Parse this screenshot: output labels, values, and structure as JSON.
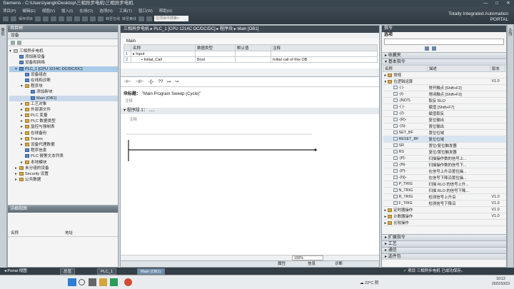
{
  "window": {
    "title": "Siemens  -  C:\\Users\\yangk\\Desktop\\三相异步电机\\三相异步电机",
    "controls": [
      "—",
      "□",
      "✕"
    ]
  },
  "menu": [
    "项目(P)",
    "编辑(E)",
    "视图(V)",
    "插入(I)",
    "在线(O)",
    "选项(N)",
    "工具(T)",
    "窗口(W)",
    "帮助(H)"
  ],
  "toolbar": {
    "save_label": "保存项目",
    "online_label": "转至在线",
    "offline_label": "转至离线",
    "search_placeholder": "在项目中搜索>"
  },
  "brand": {
    "line1": "Totally Integrated Automation",
    "line2": "PORTAL"
  },
  "project_tree": {
    "title": "项目树",
    "devices_tab": "设备",
    "side_tab": "设备",
    "items": [
      {
        "label": "三相异步电机",
        "indent": 0,
        "exp": "▾",
        "icon": "grey"
      },
      {
        "label": "添加新设备",
        "indent": 1,
        "exp": "",
        "icon": "blue"
      },
      {
        "label": "设备和网络",
        "indent": 1,
        "exp": "",
        "icon": "blue"
      },
      {
        "label": "PLC_1 [CPU 1214C DC/DC/DC]",
        "indent": 1,
        "exp": "▾",
        "icon": "blue",
        "sel": true
      },
      {
        "label": "设备组态",
        "indent": 2,
        "exp": "",
        "icon": "blue"
      },
      {
        "label": "在线和诊断",
        "indent": 2,
        "exp": "",
        "icon": "blue"
      },
      {
        "label": "程序块",
        "indent": 2,
        "exp": "▾",
        "icon": "folder"
      },
      {
        "label": "添加新块",
        "indent": 3,
        "exp": "",
        "icon": "blue"
      },
      {
        "label": "Main [OB1]",
        "indent": 3,
        "exp": "",
        "icon": "blue",
        "sel2": true
      },
      {
        "label": "工艺对象",
        "indent": 2,
        "exp": "▸",
        "icon": "folder"
      },
      {
        "label": "外部源文件",
        "indent": 2,
        "exp": "▸",
        "icon": "folder"
      },
      {
        "label": "PLC 变量",
        "indent": 2,
        "exp": "▸",
        "icon": "folder"
      },
      {
        "label": "PLC 数据类型",
        "indent": 2,
        "exp": "▸",
        "icon": "folder"
      },
      {
        "label": "监控与强制表",
        "indent": 2,
        "exp": "▸",
        "icon": "folder"
      },
      {
        "label": "在线备份",
        "indent": 2,
        "exp": "▸",
        "icon": "folder"
      },
      {
        "label": "Traces",
        "indent": 2,
        "exp": "▸",
        "icon": "folder"
      },
      {
        "label": "设备代理数据",
        "indent": 2,
        "exp": "▸",
        "icon": "folder"
      },
      {
        "label": "程序信息",
        "indent": 2,
        "exp": "",
        "icon": "blue"
      },
      {
        "label": "PLC 报警文本列表",
        "indent": 2,
        "exp": "",
        "icon": "blue"
      },
      {
        "label": "本地模块",
        "indent": 2,
        "exp": "▸",
        "icon": "folder"
      },
      {
        "label": "未分组的设备",
        "indent": 1,
        "exp": "▸",
        "icon": "folder"
      },
      {
        "label": "Security 设置",
        "indent": 1,
        "exp": "▸",
        "icon": "folder"
      },
      {
        "label": "公共数据",
        "indent": 1,
        "exp": "▸",
        "icon": "folder"
      }
    ]
  },
  "details_view": {
    "title": "详细视图",
    "col_name": "名称",
    "col_address": "地址"
  },
  "editor": {
    "breadcrumb": "三相异步电机 ▸ PLC_1 [CPU 1214C DC/DC/DC] ▸ 程序块 ▸ Main [OB1]",
    "block_name": "Main",
    "headers": [
      "名称",
      "数据类型",
      "默认值",
      "注释"
    ],
    "rows": [
      {
        "icon": "▸",
        "name": "Input",
        "type": "",
        "def": "",
        "comment": ""
      },
      {
        "icon": "▸",
        "name": "Initial_Call",
        "type": "Bool",
        "def": "",
        "comment": "Initial call of this OB"
      }
    ],
    "ladder_tools": [
      "⊣⊢",
      "⊣/⊢",
      "-()-",
      "??",
      "↦",
      "↪"
    ],
    "block_title_label": "块标题：",
    "block_title_value": "\"Main Program Sweep (Cycle)\"",
    "block_comment": "注释",
    "network_label": "程序段 1：",
    "network_dots": ".....",
    "network_comment": "注释",
    "zoom": "100%",
    "tabs": [
      "属性",
      "信息",
      "诊断"
    ]
  },
  "instructions": {
    "title": "指令",
    "options": "选项",
    "favorites": "收藏夹",
    "basic": "基本指令",
    "cols": [
      "名称",
      "描述",
      "版本"
    ],
    "list": [
      {
        "name": "常规",
        "desc": "",
        "ver": "",
        "exp": "▸",
        "folder": true
      },
      {
        "name": "位逻辑运算",
        "desc": "",
        "ver": "V1.0",
        "exp": "▾",
        "folder": true
      },
      {
        "name": "-| |-",
        "desc": "常开触点 [Shift+F2]",
        "ver": ""
      },
      {
        "name": "-|/|-",
        "desc": "常闭触点 [Shift+F3]",
        "ver": ""
      },
      {
        "name": "-|NOT|-",
        "desc": "取反 RLO",
        "ver": ""
      },
      {
        "name": "-( )-",
        "desc": "赋值 [Shift+F7]",
        "ver": ""
      },
      {
        "name": "-(/)-",
        "desc": "赋值取反",
        "ver": ""
      },
      {
        "name": "-(R)-",
        "desc": "复位输出",
        "ver": ""
      },
      {
        "name": "-(S)-",
        "desc": "置位输出",
        "ver": ""
      },
      {
        "name": "SET_BF",
        "desc": "置位位域",
        "ver": ""
      },
      {
        "name": "RESET_BF",
        "desc": "复位位域",
        "ver": "",
        "sel": true
      },
      {
        "name": "SR",
        "desc": "置位/复位触发器",
        "ver": ""
      },
      {
        "name": "RS",
        "desc": "复位/置位触发器",
        "ver": ""
      },
      {
        "name": "-|P|-",
        "desc": "扫描操作数的信号上...",
        "ver": ""
      },
      {
        "name": "-|N|-",
        "desc": "扫描操作数的信号下...",
        "ver": ""
      },
      {
        "name": "-(P)-",
        "desc": "在信号上升沿置位操...",
        "ver": ""
      },
      {
        "name": "-(N)-",
        "desc": "在信号下降沿置位操...",
        "ver": ""
      },
      {
        "name": "P_TRIG",
        "desc": "扫描 RLO 的信号上升...",
        "ver": ""
      },
      {
        "name": "N_TRIG",
        "desc": "扫描 RLO 的信号下降...",
        "ver": ""
      },
      {
        "name": "R_TRIG",
        "desc": "检测信号上升沿",
        "ver": "V1.0"
      },
      {
        "name": "F_TRIG",
        "desc": "检测信号下降沿",
        "ver": "V1.0"
      },
      {
        "name": "定时器操作",
        "desc": "",
        "ver": "V1.0",
        "exp": "▸",
        "folder": true
      },
      {
        "name": "计数器操作",
        "desc": "",
        "ver": "V1.0",
        "exp": "▸",
        "folder": true
      },
      {
        "name": "比较操作",
        "desc": "",
        "ver": "",
        "exp": "▸",
        "folder": true
      }
    ],
    "bottom_sections": [
      "扩展指令",
      "工艺",
      "通信",
      "选件包"
    ]
  },
  "portal_bar": {
    "portal_view": "Portal 视图",
    "tabs": [
      "总览",
      "PLC_1",
      "Main (OB1)"
    ],
    "status": "项目 三相异步电机 已成功保存。"
  },
  "taskbar": {
    "weather": "22°C 阴",
    "time": "10:12",
    "date": "2022/10/23"
  },
  "colors": {
    "accent": "#6d8db0",
    "titlebar": "#3a4650",
    "selection": "#aacbe8"
  }
}
